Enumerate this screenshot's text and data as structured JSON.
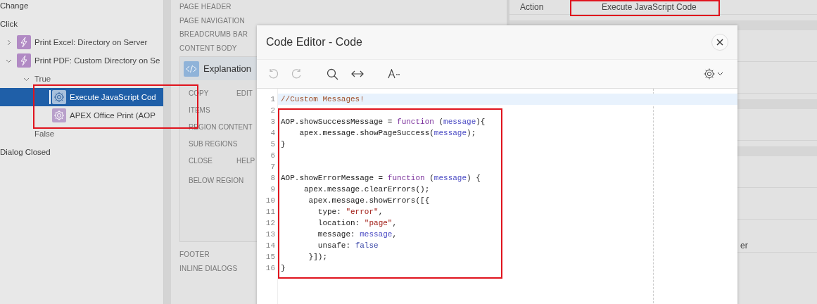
{
  "tree": [
    {
      "label": "Change",
      "kind": "event",
      "selected": false
    },
    {
      "label": "Click",
      "kind": "event",
      "selected": false,
      "children": [
        {
          "label": "Print Excel: Directory on Server",
          "kind": "dynamic-action",
          "selected": false,
          "expanded": false
        },
        {
          "label": "Print PDF: Custom Directory on Se",
          "kind": "dynamic-action",
          "selected": false,
          "expanded": true,
          "children": [
            {
              "label": "True",
              "kind": "branch",
              "selected": false,
              "expanded": true,
              "children": [
                {
                  "label": "Execute JavaScript Cod",
                  "kind": "action",
                  "selected": true
                },
                {
                  "label": "APEX Office Print (AOP",
                  "kind": "action",
                  "selected": false
                }
              ]
            },
            {
              "label": "False",
              "kind": "branch",
              "selected": false
            }
          ]
        }
      ]
    },
    {
      "label": "Dialog Closed",
      "kind": "event",
      "selected": false
    }
  ],
  "layout": {
    "positions_top": [
      "PAGE HEADER",
      "PAGE NAVIGATION",
      "BREADCRUMB BAR",
      "CONTENT BODY"
    ],
    "region": {
      "title": "Explanation",
      "slots": [
        [
          "COPY",
          "EDIT"
        ],
        [
          "ITEMS"
        ],
        [
          "REGION CONTENT"
        ],
        [
          "SUB REGIONS"
        ],
        [
          "CLOSE",
          "HELP"
        ],
        [
          "BELOW REGION"
        ]
      ]
    },
    "positions_bottom": [
      "FOOTER",
      "INLINE DIALOGS"
    ]
  },
  "properties": {
    "rows": [
      {
        "label": "Action",
        "value": "Execute JavaScript Code"
      }
    ],
    "cut_value": "er"
  },
  "modal": {
    "title": "Code Editor - Code",
    "toolbar": [
      {
        "kind": "undo",
        "disabled": true
      },
      {
        "kind": "redo",
        "disabled": true
      },
      {
        "kind": "search",
        "disabled": false
      },
      {
        "kind": "replace",
        "disabled": false
      },
      {
        "kind": "font",
        "disabled": false
      }
    ],
    "lines": [
      {
        "number": "1",
        "current": true,
        "tokens": [
          {
            "t": "//Custom Messages!",
            "kind": "comment"
          }
        ]
      },
      {
        "number": "2",
        "current": false
      },
      {
        "number": "3",
        "current": false,
        "tokens": [
          {
            "t": "AOP.showSuccessMessage = ",
            "kind": "plain"
          },
          {
            "t": "function",
            "kind": "keyword"
          },
          {
            "t": " (",
            "kind": "plain"
          },
          {
            "t": "message",
            "kind": "variable"
          },
          {
            "t": "){",
            "kind": "plain"
          }
        ]
      },
      {
        "number": "4",
        "current": false,
        "tokens": [
          {
            "t": "    apex.message.showPageSuccess(",
            "kind": "plain"
          },
          {
            "t": "message",
            "kind": "variable"
          },
          {
            "t": ");",
            "kind": "plain"
          }
        ]
      },
      {
        "number": "5",
        "current": false,
        "tokens": [
          {
            "t": "}",
            "kind": "plain"
          }
        ]
      },
      {
        "number": "6",
        "current": false
      },
      {
        "number": "7",
        "current": false
      },
      {
        "number": "8",
        "current": false,
        "tokens": [
          {
            "t": "AOP.showErrorMessage = ",
            "kind": "plain"
          },
          {
            "t": "function",
            "kind": "keyword"
          },
          {
            "t": " (",
            "kind": "plain"
          },
          {
            "t": "message",
            "kind": "variable"
          },
          {
            "t": ") {",
            "kind": "plain"
          }
        ]
      },
      {
        "number": "9",
        "current": false,
        "tokens": [
          {
            "t": "     apex.message.clearErrors();",
            "kind": "plain"
          }
        ]
      },
      {
        "number": "10",
        "current": false,
        "tokens": [
          {
            "t": "      apex.message.showErrors([{",
            "kind": "plain"
          }
        ]
      },
      {
        "number": "11",
        "current": false,
        "tokens": [
          {
            "t": "        type: ",
            "kind": "plain"
          },
          {
            "t": "\"error\"",
            "kind": "string"
          },
          {
            "t": ",",
            "kind": "plain"
          }
        ]
      },
      {
        "number": "12",
        "current": false,
        "tokens": [
          {
            "t": "        location: ",
            "kind": "plain"
          },
          {
            "t": "\"page\"",
            "kind": "string"
          },
          {
            "t": ",",
            "kind": "plain"
          }
        ]
      },
      {
        "number": "13",
        "current": false,
        "tokens": [
          {
            "t": "        message: ",
            "kind": "plain"
          },
          {
            "t": "message",
            "kind": "variable"
          },
          {
            "t": ",",
            "kind": "plain"
          }
        ]
      },
      {
        "number": "14",
        "current": false,
        "tokens": [
          {
            "t": "        unsafe: ",
            "kind": "plain"
          },
          {
            "t": "false",
            "kind": "atom"
          }
        ]
      },
      {
        "number": "15",
        "current": false,
        "tokens": [
          {
            "t": "      }]);",
            "kind": "plain"
          }
        ]
      },
      {
        "number": "16",
        "current": false,
        "tokens": [
          {
            "t": "}",
            "kind": "plain"
          }
        ]
      }
    ]
  }
}
